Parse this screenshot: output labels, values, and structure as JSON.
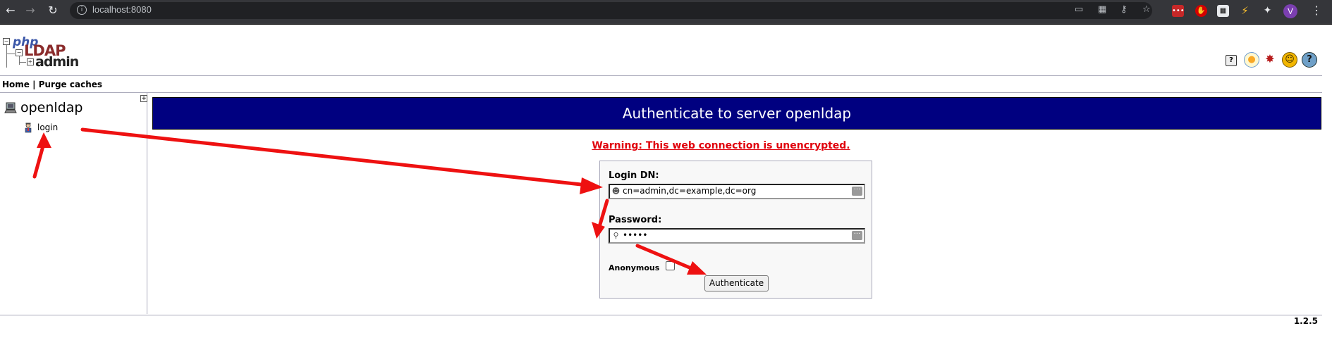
{
  "browser": {
    "url": "localhost:8080",
    "profile_initial": "V",
    "toolbar_icons": [
      "back-icon",
      "forward-icon",
      "reload-icon",
      "info-icon",
      "cast-icon",
      "qr-icon",
      "key-icon",
      "star-icon"
    ],
    "extensions": [
      "lastpass-ext",
      "ublock-ext",
      "qr-ext",
      "bolt-ext",
      "puzzle-ext"
    ]
  },
  "app": {
    "logo": {
      "php": "php",
      "ldap": "LDAP",
      "admin": "admin"
    },
    "header_icons": [
      "help-icon",
      "idea-icon",
      "bug-icon",
      "smiley-icon",
      "donate-icon"
    ],
    "menu": {
      "home": "Home",
      "separator": "|",
      "purge": "Purge caches"
    },
    "version": "1.2.5"
  },
  "tree": {
    "server": "openldap",
    "login_label": "login"
  },
  "main": {
    "title": "Authenticate to server openldap",
    "warning": "Warning: This web connection is unencrypted.",
    "login_dn_label": "Login DN:",
    "login_dn_value": "cn=admin,dc=example,dc=org",
    "password_label": "Password:",
    "password_value": "•••••",
    "anonymous_label": "Anonymous",
    "authenticate_label": "Authenticate"
  },
  "annotation_colors": {
    "arrow": "#ee1111"
  }
}
